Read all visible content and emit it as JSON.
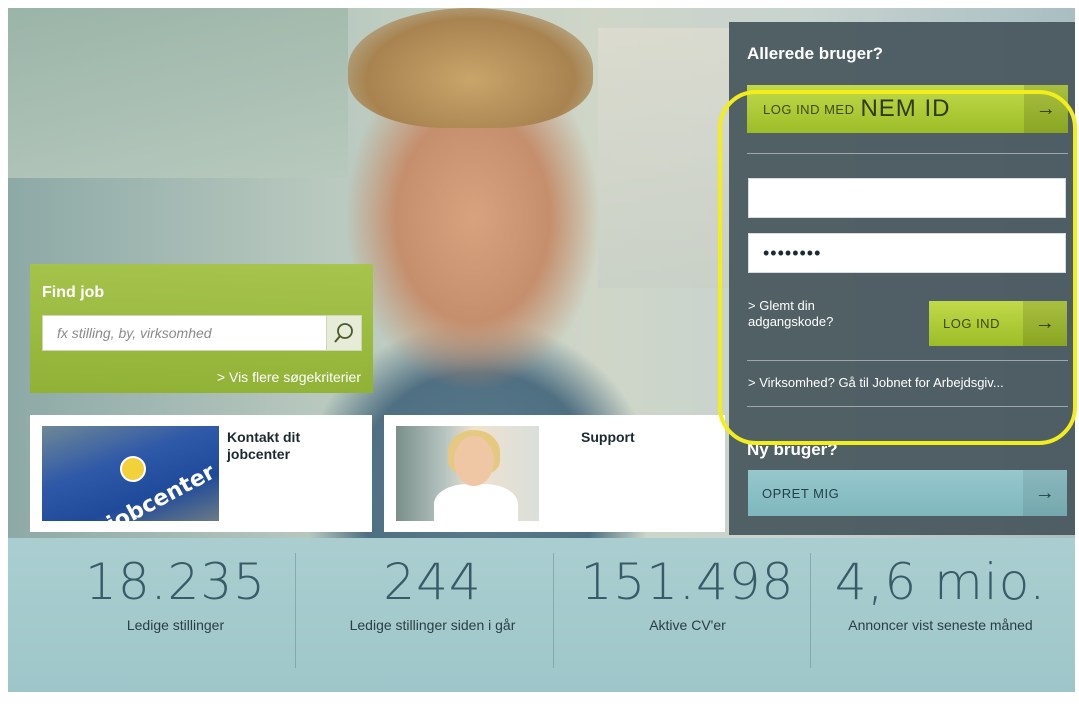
{
  "login": {
    "title": "Allerede bruger?",
    "nemid_prefix": "LOG IND MED",
    "nemid_logo": "NEM ID",
    "username_value": "",
    "password_value": "••••••••",
    "forgot_label": "> Glemt din adgangskode?",
    "login_button": "LOG IND",
    "business_link": "> Virksomhed? Gå til Jobnet for Arbejdsgiv...",
    "new_user_title": "Ny bruger?",
    "create_button": "OPRET MIG",
    "arrow": "→"
  },
  "find_job": {
    "title": "Find job",
    "search_placeholder": "fx stilling, by, virksomhed",
    "more_criteria": "> Vis flere søgekriterier"
  },
  "tiles": [
    {
      "title": "Kontakt dit jobcenter",
      "image_text": "jobcenter"
    },
    {
      "title": "Support"
    }
  ],
  "stats": [
    {
      "value": "18.235",
      "label": "Ledige stillinger"
    },
    {
      "value": "244",
      "label": "Ledige stillinger siden i går"
    },
    {
      "value": "151.498",
      "label": "Aktive CV'er"
    },
    {
      "value": "4,6 mio.",
      "label": "Annoncer vist seneste måned"
    }
  ],
  "colors": {
    "accent_green": "#9dbd27",
    "panel_dark": "#46565c",
    "highlight_yellow": "#f2ee1d",
    "teal_button": "#7fb7bd"
  }
}
